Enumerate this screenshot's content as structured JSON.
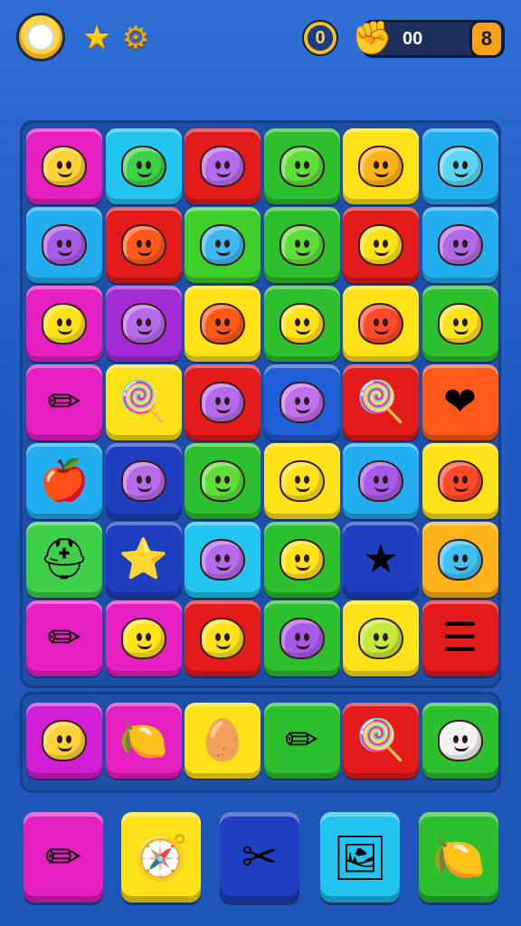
{
  "hud": {
    "coin_label": "0",
    "score": "00",
    "level": "8",
    "icons": [
      "sun-icon",
      "star-icon",
      "gear-icon",
      "coin-icon",
      "fist-icon"
    ],
    "colors": {
      "gold": "#f4c21c",
      "score_bg": "#1f2f5e",
      "level_badge": "#f7a21b"
    }
  },
  "board": {
    "rows": [
      [
        {
          "c": "#e61fc0",
          "k": "face",
          "f": "#ffd23a"
        },
        {
          "c": "#22c4f0",
          "k": "face",
          "f": "#3fd04a"
        },
        {
          "c": "#e31b1b",
          "k": "face",
          "f": "#b56bea"
        },
        {
          "c": "#2ebf2e",
          "k": "face",
          "f": "#5fdd3a"
        },
        {
          "c": "#ffe21a",
          "k": "face",
          "f": "#ffb21a"
        },
        {
          "c": "#22aef0",
          "k": "face",
          "f": "#5ad4f0"
        }
      ],
      [
        {
          "c": "#22aef0",
          "k": "face",
          "f": "#a85ae8"
        },
        {
          "c": "#e31b1b",
          "k": "face",
          "f": "#ff5a1a"
        },
        {
          "c": "#3fcf2a",
          "k": "face",
          "f": "#3fb8f0"
        },
        {
          "c": "#2ebf2e",
          "k": "face",
          "f": "#5fdd3a"
        },
        {
          "c": "#e31b1b",
          "k": "face",
          "f": "#ffe21a"
        },
        {
          "c": "#22aef0",
          "k": "face",
          "f": "#b06ae8"
        }
      ],
      [
        {
          "c": "#e61fc0",
          "k": "face",
          "f": "#ffe21a"
        },
        {
          "c": "#a22bd6",
          "k": "face",
          "f": "#b56bea"
        },
        {
          "c": "#ffe21a",
          "k": "face",
          "f": "#ff5a1a"
        },
        {
          "c": "#2ebf2e",
          "k": "face",
          "f": "#ffe21a"
        },
        {
          "c": "#ffe21a",
          "k": "face",
          "f": "#ff4a2a"
        },
        {
          "c": "#2ebf2e",
          "k": "face",
          "f": "#ffe21a"
        }
      ],
      [
        {
          "c": "#e61fc0",
          "k": "glyph",
          "g": "✏",
          "n": "pencil-icon"
        },
        {
          "c": "#ffe21a",
          "k": "glyph",
          "g": "🍭",
          "n": "candy-icon"
        },
        {
          "c": "#e31b1b",
          "k": "face",
          "f": "#b56bea"
        },
        {
          "c": "#1f5ed6",
          "k": "face",
          "f": "#c070ea"
        },
        {
          "c": "#e31b1b",
          "k": "glyph",
          "g": "🍭",
          "n": "candy-icon"
        },
        {
          "c": "#ff5a1a",
          "k": "glyph",
          "g": "❤",
          "n": "heart-icon"
        }
      ],
      [
        {
          "c": "#22aef0",
          "k": "glyph",
          "g": "🍎",
          "n": "apple-icon"
        },
        {
          "c": "#1f3fc0",
          "k": "face",
          "f": "#b56bea"
        },
        {
          "c": "#2ebf2e",
          "k": "face",
          "f": "#5fdd3a"
        },
        {
          "c": "#ffe21a",
          "k": "face",
          "f": "#ffe21a"
        },
        {
          "c": "#22aef0",
          "k": "face",
          "f": "#a85ae8"
        },
        {
          "c": "#ffe21a",
          "k": "face",
          "f": "#ff4a2a"
        }
      ],
      [
        {
          "c": "#3fcf4a",
          "k": "glyph",
          "g": "⛑",
          "n": "hat-icon"
        },
        {
          "c": "#1f3fc0",
          "k": "glyph",
          "g": "⭐",
          "n": "star-wand-icon"
        },
        {
          "c": "#22c4f0",
          "k": "face",
          "f": "#b56bea"
        },
        {
          "c": "#2ebf2e",
          "k": "face",
          "f": "#ffe21a"
        },
        {
          "c": "#1f3fc0",
          "k": "glyph",
          "g": "★",
          "n": "red-star-icon"
        },
        {
          "c": "#ffb21a",
          "k": "face",
          "f": "#3fc0f0"
        }
      ],
      [
        {
          "c": "#e61fc0",
          "k": "glyph",
          "g": "✏",
          "n": "pencil-icon"
        },
        {
          "c": "#e61fc0",
          "k": "face",
          "f": "#ffe21a"
        },
        {
          "c": "#e31b1b",
          "k": "face",
          "f": "#ffe21a"
        },
        {
          "c": "#2ebf2e",
          "k": "face",
          "f": "#a85ae8"
        },
        {
          "c": "#ffe21a",
          "k": "face",
          "f": "#c6e83a"
        },
        {
          "c": "#e31b1b",
          "k": "glyph",
          "g": "☰",
          "n": "list-icon"
        }
      ]
    ],
    "row2": [
      {
        "c": "#d21fd6",
        "k": "face",
        "f": "#ffd23a"
      },
      {
        "c": "#e61fc0",
        "k": "glyph",
        "g": "🍋",
        "n": "lemon-icon"
      },
      {
        "c": "#ffe21a",
        "k": "glyph",
        "g": "🥚",
        "n": "egg-icon"
      },
      {
        "c": "#2ebf2e",
        "k": "glyph",
        "g": "✏",
        "n": "pencil-icon"
      },
      {
        "c": "#e31b1b",
        "k": "glyph",
        "g": "🍭",
        "n": "candy-icon"
      },
      {
        "c": "#2ebf2e",
        "k": "face",
        "f": "#f2f2f2"
      }
    ]
  },
  "tray": [
    {
      "c": "#e61fc0",
      "g": "✏",
      "n": "pencil-icon"
    },
    {
      "c": "#ffe21a",
      "g": "🧭",
      "n": "compass-icon"
    },
    {
      "c": "#1f3fc0",
      "g": "✂",
      "n": "tools-icon"
    },
    {
      "c": "#22c4f0",
      "g": "🖼",
      "n": "frame-icon"
    },
    {
      "c": "#2ebf2e",
      "g": "🍋",
      "n": "lemon-icon"
    }
  ]
}
